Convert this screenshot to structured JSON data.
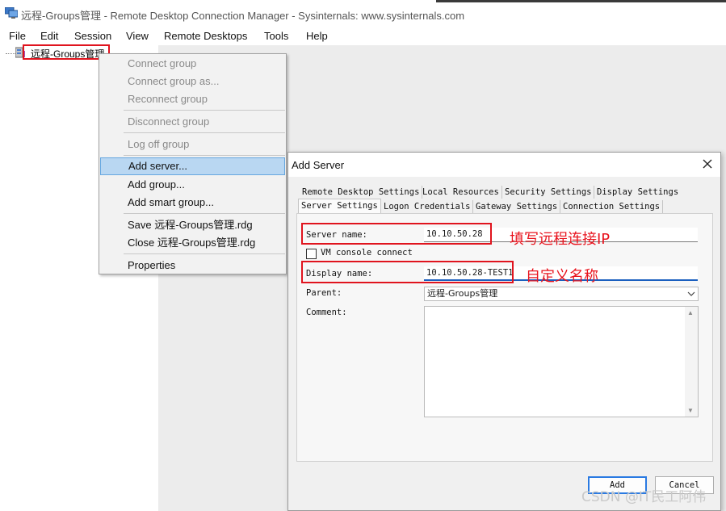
{
  "window": {
    "title": "远程-Groups管理 - Remote Desktop Connection Manager - Sysinternals: www.sysinternals.com",
    "icon": "rdcman-app-icon"
  },
  "menubar": {
    "items": [
      "File",
      "Edit",
      "Session",
      "View",
      "Remote Desktops",
      "Tools",
      "Help"
    ]
  },
  "tree": {
    "root_label": "远程-Groups管理",
    "root_icon": "server-group-icon"
  },
  "context_menu": {
    "items": [
      {
        "label": "Connect group",
        "enabled": false
      },
      {
        "label": "Connect group as...",
        "enabled": false
      },
      {
        "label": "Reconnect group",
        "enabled": false
      },
      {
        "label": "Disconnect group",
        "enabled": false
      },
      {
        "label": "Log off group",
        "enabled": false
      },
      {
        "label": "Add server...",
        "enabled": true,
        "highlighted": true
      },
      {
        "label": "Add group...",
        "enabled": true
      },
      {
        "label": "Add smart group...",
        "enabled": true
      },
      {
        "label": "Save 远程-Groups管理.rdg",
        "enabled": true
      },
      {
        "label": "Close 远程-Groups管理.rdg",
        "enabled": true
      },
      {
        "label": "Properties",
        "enabled": true
      }
    ]
  },
  "dialog": {
    "title": "Add Server",
    "tabs_row1": [
      "Remote Desktop Settings",
      "Local Resources",
      "Security Settings",
      "Display Settings"
    ],
    "tabs_row2": [
      "Server Settings",
      "Logon Credentials",
      "Gateway Settings",
      "Connection Settings"
    ],
    "active_tab": "Server Settings",
    "server_name_label": "Server name:",
    "server_name_value": "10.10.50.28",
    "vm_console_label": "VM console connect",
    "vm_console_checked": false,
    "display_name_label": "Display name:",
    "display_name_value": "10.10.50.28-TEST1",
    "parent_label": "Parent:",
    "parent_value": "远程-Groups管理",
    "comment_label": "Comment:",
    "comment_value": "",
    "add_button": "Add",
    "cancel_button": "Cancel"
  },
  "annotations": {
    "server_note": "填写远程连接IP",
    "display_note": "自定义名称",
    "color": "#e8141e"
  },
  "watermark": "CSDN @IT民工阿伟"
}
